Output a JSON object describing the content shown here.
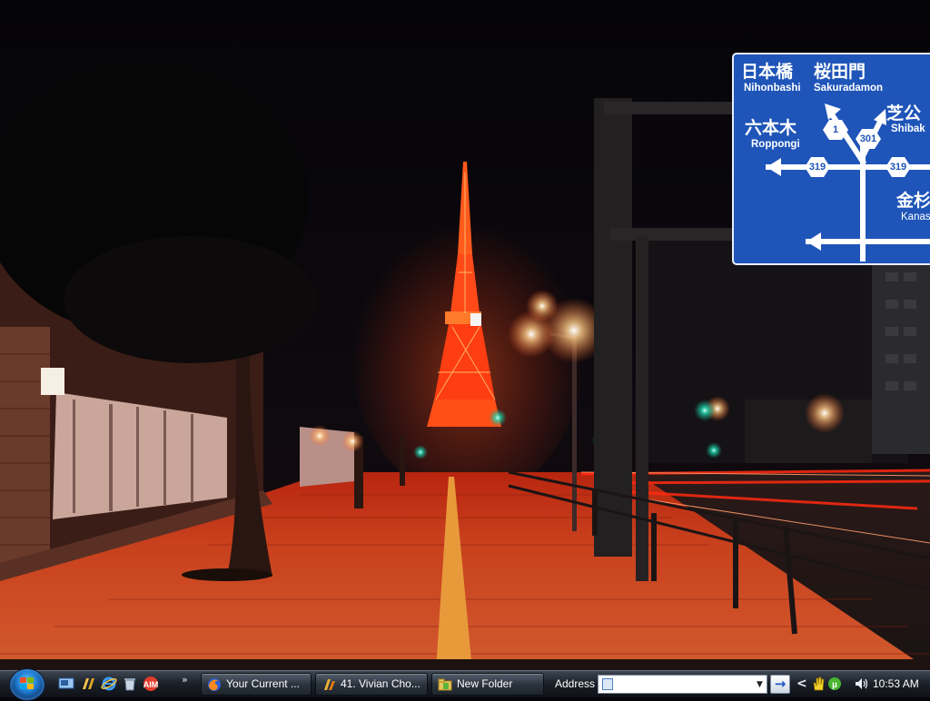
{
  "desktop": {
    "wallpaper": "tokyo-tower-night-street",
    "road_sign": {
      "top_left_jp": "日本橋",
      "top_left_en": "Nihonbashi",
      "top_right_jp": "桜田門",
      "top_right_en": "Sakuradamon",
      "left_jp": "六本木",
      "left_en": "Roppongi",
      "right_jp": "芝公",
      "right_en": "Shibak",
      "lower_right_jp": "金杉",
      "lower_right_en": "Kanas",
      "route_1": "1",
      "route_301": "301",
      "route_319_left": "319",
      "route_319_right": "319",
      "color": "#1f55b8"
    }
  },
  "taskbar": {
    "start_button": "windows-start-orb",
    "quick_launch": [
      {
        "name": "show-desktop-icon"
      },
      {
        "name": "window-switcher-icon"
      },
      {
        "name": "internet-explorer-icon"
      },
      {
        "name": "recycle-bin-icon"
      },
      {
        "name": "aim-icon"
      }
    ],
    "quick_launch_more": "»",
    "tasks": [
      {
        "label": "Your Current ...",
        "icon": "firefox-icon"
      },
      {
        "label": "41. Vivian Cho...",
        "icon": "winamp-icon"
      },
      {
        "label": "New Folder",
        "icon": "folder-icon"
      }
    ],
    "address": {
      "label": "Address",
      "value": "",
      "go": "→"
    },
    "tray": {
      "expand": "<",
      "clock": "10:53 AM"
    }
  }
}
